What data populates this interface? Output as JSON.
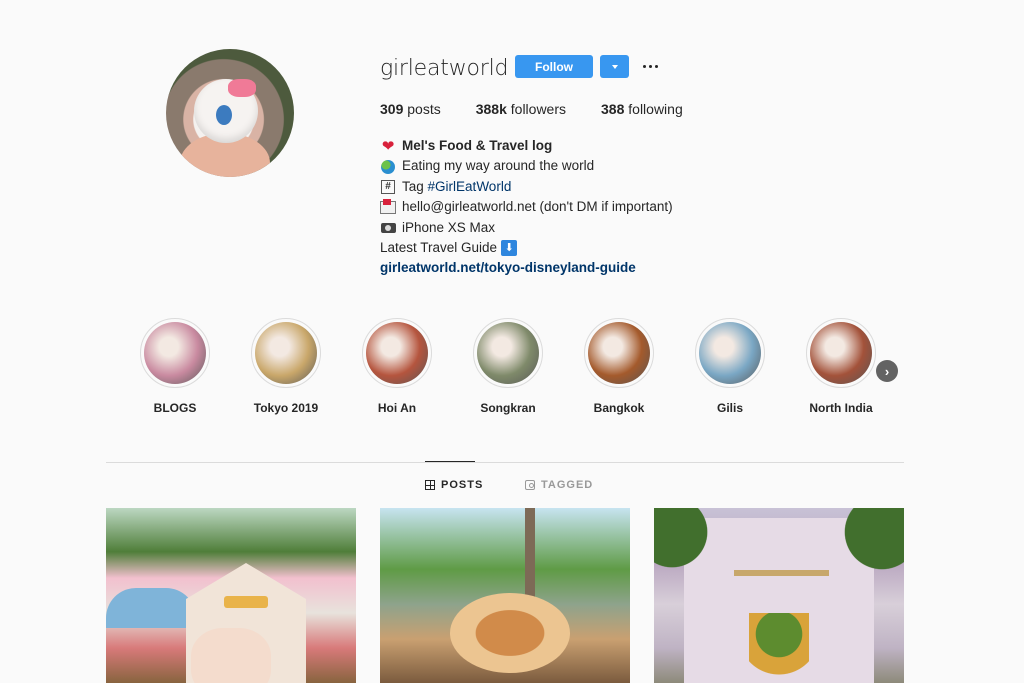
{
  "profile": {
    "username": "girleatworld",
    "follow_label": "Follow",
    "stats": {
      "posts_count": "309",
      "posts_label": "posts",
      "followers_count": "388k",
      "followers_label": "followers",
      "following_count": "388",
      "following_label": "following"
    },
    "bio": {
      "name": "Mel's Food & Travel log",
      "line1": "Eating my way around the world",
      "tag_prefix": "Tag",
      "hashtag": "#GirlEatWorld",
      "email_line": "hello@girleatworld.net (don't DM if important)",
      "device_line": "iPhone XS Max",
      "guide_line": "Latest Travel Guide",
      "guide_icon": "⬇",
      "link": "girleatworld.net/tokyo-disneyland-guide",
      "hash_icon": "#"
    }
  },
  "highlights": [
    {
      "label": "BLOGS",
      "color": "#c98aa0"
    },
    {
      "label": "Tokyo 2019",
      "color": "#c9a76a"
    },
    {
      "label": "Hoi An",
      "color": "#b5553e"
    },
    {
      "label": "Songkran",
      "color": "#7f8a6a"
    },
    {
      "label": "Bangkok",
      "color": "#a45a2c"
    },
    {
      "label": "Gilis",
      "color": "#7aa7c4"
    },
    {
      "label": "North India",
      "color": "#a3523a"
    }
  ],
  "next_icon": "›",
  "tabs": {
    "posts": "POSTS",
    "tagged": "TAGGED"
  },
  "colors": {
    "accent": "#3897f0",
    "link": "#003569"
  }
}
